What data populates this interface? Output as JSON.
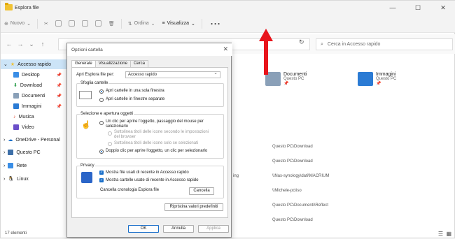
{
  "window": {
    "title": "Esplora file"
  },
  "toolbar": {
    "new_label": "Nuovo",
    "sort_label": "Ordina",
    "view_label": "Visualizza",
    "more_label": "···"
  },
  "search": {
    "placeholder": "Cerca in Accesso rapido"
  },
  "sidebar": {
    "items": [
      {
        "label": "Accesso rapido"
      },
      {
        "label": "Desktop"
      },
      {
        "label": "Download"
      },
      {
        "label": "Documenti"
      },
      {
        "label": "Immagini"
      },
      {
        "label": "Musica"
      },
      {
        "label": "Video"
      },
      {
        "label": "OneDrive - Personal"
      },
      {
        "label": "Questo PC"
      },
      {
        "label": "Rete"
      },
      {
        "label": "Linux"
      }
    ]
  },
  "content": {
    "tiles": [
      {
        "name": "Documenti",
        "sub": "Questo PC"
      },
      {
        "name": "Immagini",
        "sub": "Questo PC"
      }
    ],
    "paths": [
      "Questo PC\\Download",
      "Questo PC\\Download",
      "\\\\Nas-synology\\dati\\MACRIUM",
      "\\\\Michele-pc\\iso",
      "Questo PC\\Documenti\\Reflect",
      "Questo PC\\Download"
    ],
    "partial_text": "ing"
  },
  "status": {
    "count": "17 elementi"
  },
  "dialog": {
    "title": "Opzioni cartella",
    "tabs": [
      "Generale",
      "Visualizzazione",
      "Cerca"
    ],
    "open_label": "Apri Esplora file per:",
    "open_value": "Accesso rapido",
    "browse_title": "Sfoglia cartelle",
    "browse_same": "Apri cartelle in una sola finestra",
    "browse_separate": "Apri cartelle in finestre separate",
    "click_title": "Selezione e apertura oggetti",
    "single_click_1": "Un clic per aprire l'oggetto, passaggio del mouse per",
    "single_click_2": "selezionarlo",
    "underline_browser_1": "Sottolinea titoli delle icone secondo le impostazioni",
    "underline_browser_2": "del browser",
    "underline_hover": "Sottolinea titoli delle icone solo se selezionati",
    "double_click": "Doppio clic per aprire l'oggetto, un clic per selezionarlo",
    "privacy_title": "Privacy",
    "recent_files": "Mostra file usati di recente in Accesso rapido",
    "recent_folders": "Mostra cartelle usate di recente in Accesso rapido",
    "clear_history": "Cancella cronologia Esplora file",
    "clear_button": "Cancella",
    "restore_button": "Ripristina valori predefiniti",
    "ok": "OK",
    "cancel": "Annulla",
    "apply": "Applica"
  }
}
